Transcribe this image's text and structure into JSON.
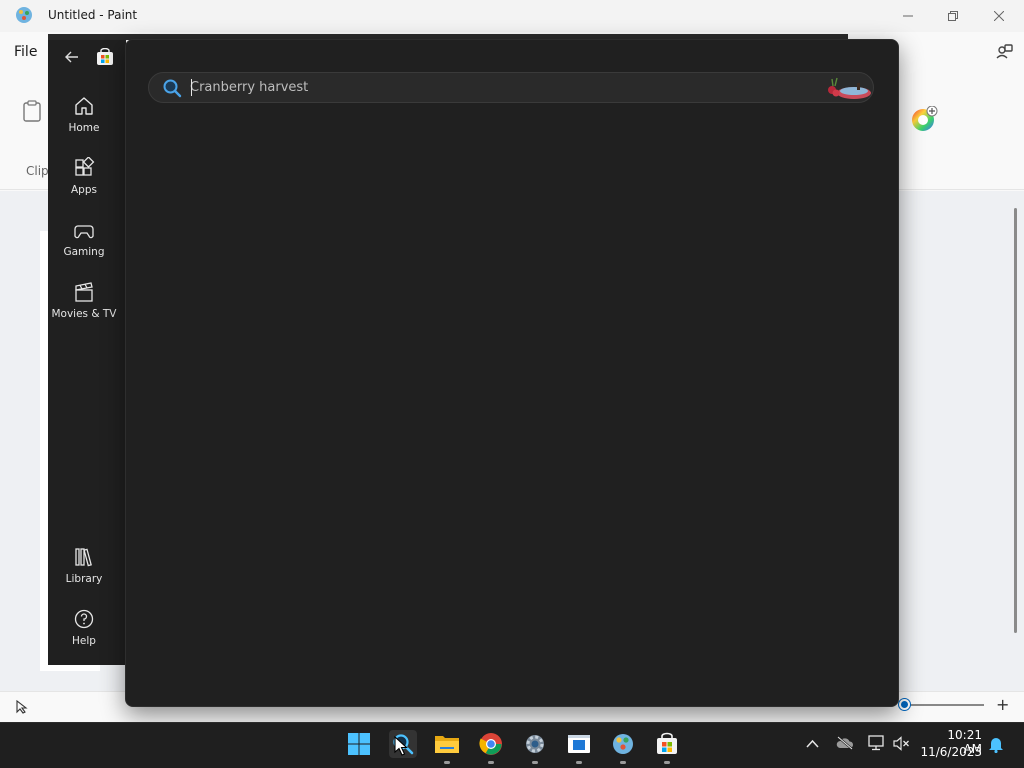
{
  "paint": {
    "title": "Untitled - Paint",
    "menu_file": "File",
    "ribbon_clip_label": "Clip",
    "window_controls": {
      "minimize_icon": "minimize-icon",
      "maximize_icon": "restore-icon",
      "close_icon": "close-icon"
    }
  },
  "store": {
    "nav": {
      "back_icon": "back-arrow-icon",
      "items": [
        {
          "label": "Home",
          "icon": "home-icon"
        },
        {
          "label": "Apps",
          "icon": "apps-icon"
        },
        {
          "label": "Gaming",
          "icon": "gamepad-icon"
        },
        {
          "label": "Movies & TV",
          "icon": "clapperboard-icon"
        }
      ],
      "bottom_items": [
        {
          "label": "Library",
          "icon": "library-icon"
        },
        {
          "label": "Help",
          "icon": "help-icon"
        }
      ]
    },
    "search": {
      "placeholder": "Cranberry harvest",
      "value": ""
    }
  },
  "taskbar": {
    "apps": [
      "start-icon",
      "search-icon",
      "file-explorer-icon",
      "chrome-icon",
      "settings-icon",
      "notepad-icon",
      "paint-icon",
      "store-icon"
    ],
    "time": "10:21 AM",
    "date": "11/6/2023"
  },
  "colors": {
    "accent": "#0067c0",
    "store_bg": "#202020",
    "taskbar_bg": "#1f1f1f"
  }
}
